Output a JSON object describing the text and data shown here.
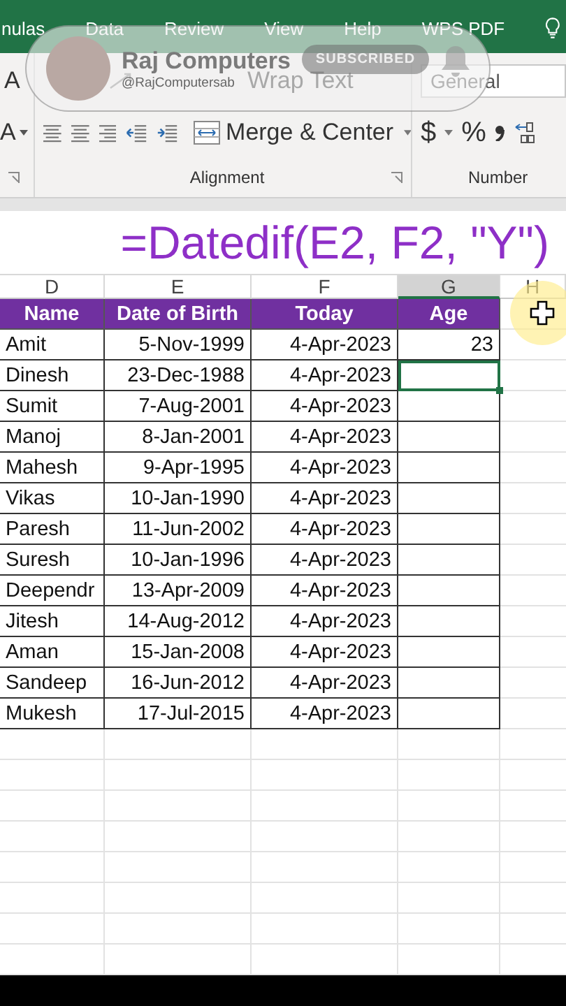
{
  "ribbon_tabs": [
    "nulas",
    "Data",
    "Review",
    "View",
    "Help",
    "WPS PDF"
  ],
  "ribbon": {
    "font_grow": "A",
    "font_color": "A",
    "wrap_text": "Wrap Text",
    "merge_center": "Merge & Center",
    "number_format": "General",
    "currency": "$",
    "percent": "%",
    "groups": [
      "Alignment",
      "Number"
    ]
  },
  "channel_overlay": {
    "channel": "Raj Computers",
    "handle": "@RajComputersab",
    "subscribe": "SUBSCRIBED"
  },
  "formula_caption": "=Datedif(E2, F2, \"Y\")",
  "columns": [
    {
      "label": "D",
      "selected": false
    },
    {
      "label": "E",
      "selected": false
    },
    {
      "label": "F",
      "selected": false
    },
    {
      "label": "G",
      "selected": true
    },
    {
      "label": "H",
      "selected": false
    }
  ],
  "table": {
    "headers": [
      "Name",
      "Date of Birth",
      "Today",
      "Age"
    ],
    "rows": [
      {
        "name": "Amit",
        "dob": "5-Nov-1999",
        "today": "4-Apr-2023",
        "age": "23",
        "selected": false
      },
      {
        "name": "Dinesh",
        "dob": "23-Dec-1988",
        "today": "4-Apr-2023",
        "selected": true
      },
      {
        "name": "Sumit",
        "dob": "7-Aug-2001",
        "today": "4-Apr-2023",
        "selected": false
      },
      {
        "name": "Manoj",
        "dob": "8-Jan-2001",
        "today": "4-Apr-2023",
        "selected": false
      },
      {
        "name": "Mahesh",
        "dob": "9-Apr-1995",
        "today": "4-Apr-2023",
        "selected": false
      },
      {
        "name": "Vikas",
        "dob": "10-Jan-1990",
        "today": "4-Apr-2023",
        "selected": false
      },
      {
        "name": "Paresh",
        "dob": "11-Jun-2002",
        "today": "4-Apr-2023",
        "selected": false
      },
      {
        "name": "Suresh",
        "dob": "10-Jan-1996",
        "today": "4-Apr-2023",
        "selected": false
      },
      {
        "name": "Deependr",
        "dob": "13-Apr-2009",
        "today": "4-Apr-2023",
        "selected": false
      },
      {
        "name": "Jitesh",
        "dob": "14-Aug-2012",
        "today": "4-Apr-2023",
        "selected": false
      },
      {
        "name": "Aman",
        "dob": "15-Jan-2008",
        "today": "4-Apr-2023",
        "selected": false
      },
      {
        "name": "Sandeep",
        "dob": "16-Jun-2012",
        "today": "4-Apr-2023",
        "selected": false
      },
      {
        "name": "Mukesh",
        "dob": "17-Jul-2015",
        "today": "4-Apr-2023",
        "selected": false
      }
    ]
  }
}
